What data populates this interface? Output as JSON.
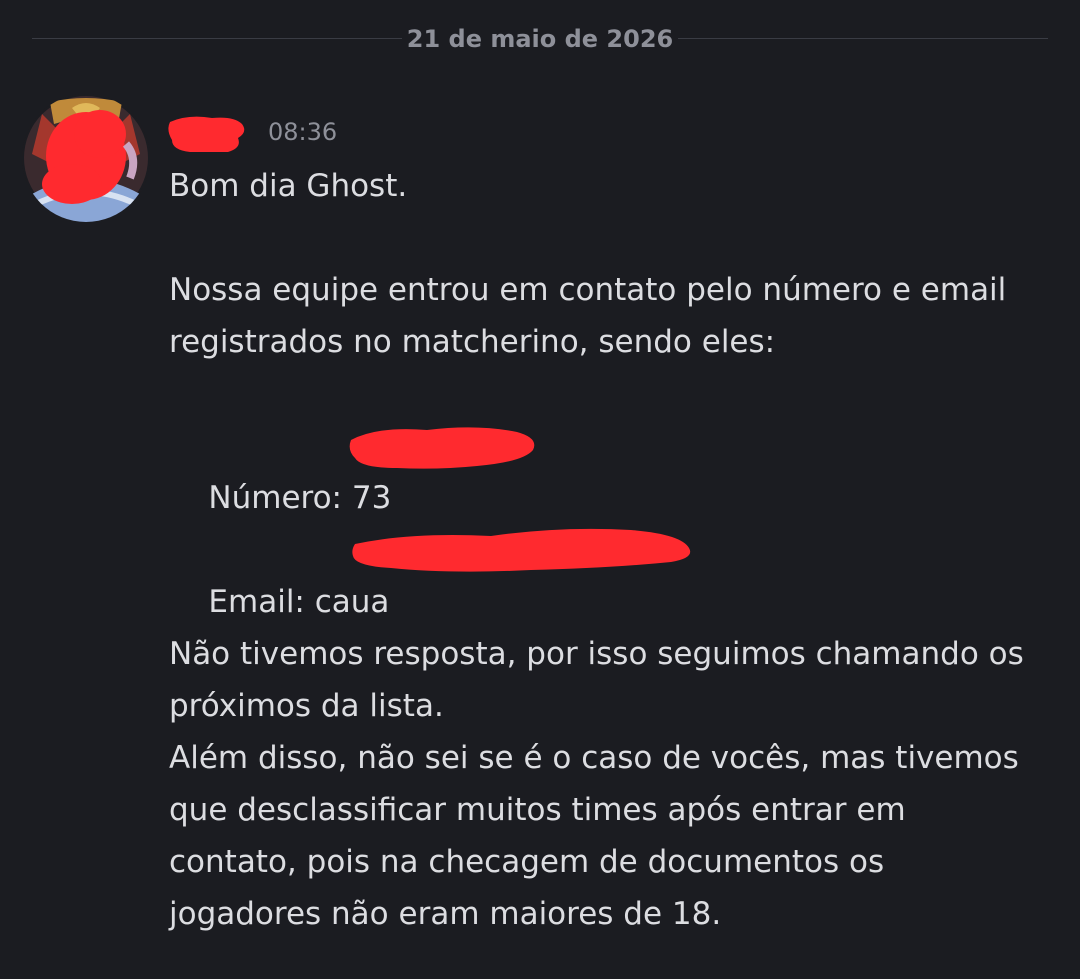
{
  "date_divider": "21 de maio de 2026",
  "message": {
    "author": "",
    "timestamp": "08:36",
    "greeting": "Bom dia Ghost.",
    "para1_line1": "Nossa equipe entrou em contato pelo número e email",
    "para1_line2": "registrados no matcherino, sendo eles:",
    "numero_label": "Número: 73",
    "email_label": "Email: caua",
    "para2_line1": "Não tivemos resposta, por isso seguimos chamando os",
    "para2_line2": "próximos da lista.",
    "para3_line1": "Além disso, não sei se é o caso de vocês, mas tivemos",
    "para3_line2": "que desclassificar muitos times após entrar em",
    "para3_line3": "contato, pois na checagem de documentos os",
    "para3_line4": "jogadores não eram maiores de 18."
  },
  "colors": {
    "background": "#1b1c21",
    "redaction": "#ff2a2f",
    "muted_text": "#8e9099",
    "body_text": "#dcdde1"
  }
}
